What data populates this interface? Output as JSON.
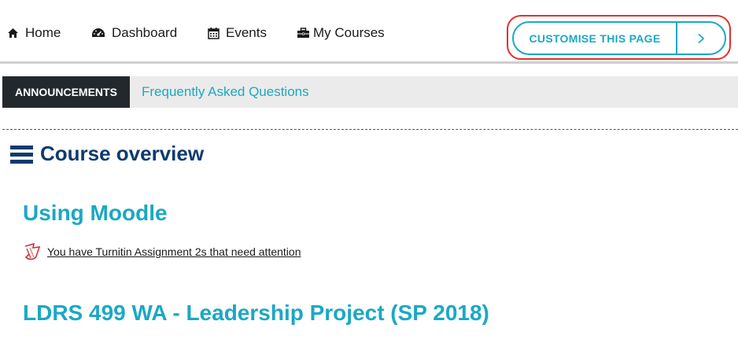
{
  "nav": {
    "items": [
      {
        "label": "Home",
        "icon": "home-icon"
      },
      {
        "label": "Dashboard",
        "icon": "dashboard-icon"
      },
      {
        "label": "Events",
        "icon": "calendar-icon"
      },
      {
        "label": "My Courses",
        "icon": "briefcase-icon"
      }
    ],
    "customise_label": "CUSTOMISE THIS PAGE",
    "customise_icon": "chevron-right-icon"
  },
  "tabs": {
    "active": "ANNOUNCEMENTS",
    "link": "Frequently Asked Questions"
  },
  "overview": {
    "title": "Course overview",
    "icon": "list-icon"
  },
  "courses": [
    {
      "title": "Using Moodle",
      "notice": "You have Turnitin Assignment 2s that need attention",
      "notice_icon": "turnitin-icon"
    },
    {
      "title": "LDRS 499 WA - Leadership Project (SP 2018)"
    }
  ],
  "colors": {
    "accent": "#1ba8c4",
    "heading": "#0f3a6e",
    "highlight": "#e0322a",
    "tab_active_bg": "#23282d"
  }
}
